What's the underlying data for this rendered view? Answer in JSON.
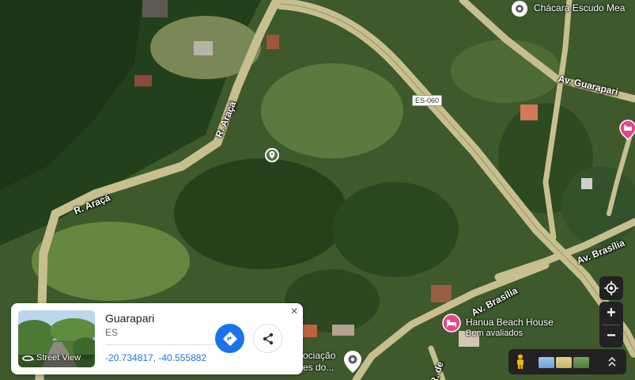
{
  "map": {
    "roads": [
      {
        "id": "r-araca-upper",
        "label": "R. Araçá"
      },
      {
        "id": "r-araca-lower",
        "label": "R. Araçá"
      },
      {
        "id": "av-guarapari",
        "label": "Av. Guarapari"
      },
      {
        "id": "av-brasilia-right",
        "label": "Av. Brasília"
      },
      {
        "id": "av-brasilia-lower",
        "label": "Av. Brasília"
      },
      {
        "id": "r-de",
        "label": "R. de"
      }
    ],
    "highway_shield": "ES-060",
    "places": {
      "chacara": "Chácara Escudo Mea",
      "hanua": {
        "name": "Hanua Beach House",
        "sub": "Bem avaliados"
      },
      "associacao_line1": "ociação",
      "associacao_line2": "es do..."
    },
    "colors": {
      "road": "#c8bf8f",
      "lodging_pin": "#e8458b",
      "place_pin": "#ffffff",
      "accent": "#1a73e8"
    }
  },
  "card": {
    "title": "Guarapari",
    "region": "ES",
    "coordinates": "-20.734817, -40.555882",
    "street_view_label": "Street View",
    "icons": {
      "directions": "directions-icon",
      "share": "share-icon",
      "close": "close-icon"
    }
  },
  "controls": {
    "zoom_in": "+",
    "zoom_out": "−"
  }
}
